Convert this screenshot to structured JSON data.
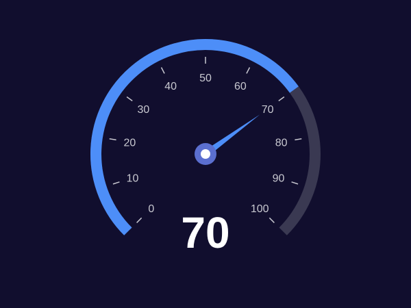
{
  "chart_data": {
    "type": "gauge",
    "value": 70,
    "value_label": "70",
    "min": 0,
    "max": 100,
    "tick_labels": [
      "0",
      "10",
      "20",
      "30",
      "40",
      "50",
      "60",
      "70",
      "80",
      "90",
      "100"
    ],
    "tick_values": [
      0,
      10,
      20,
      30,
      40,
      50,
      60,
      70,
      80,
      90,
      100
    ],
    "colors": {
      "background": "#110e2e",
      "progress": "#4d8ef8",
      "track": "#3a3952",
      "needle": "#4d8ef8",
      "hub_outer": "#5b6fd0",
      "hub_inner": "#ffffff",
      "tick_label": "#c8c8d0",
      "tick_mark": "#c8c8d0",
      "value_text": "#ffffff"
    }
  }
}
